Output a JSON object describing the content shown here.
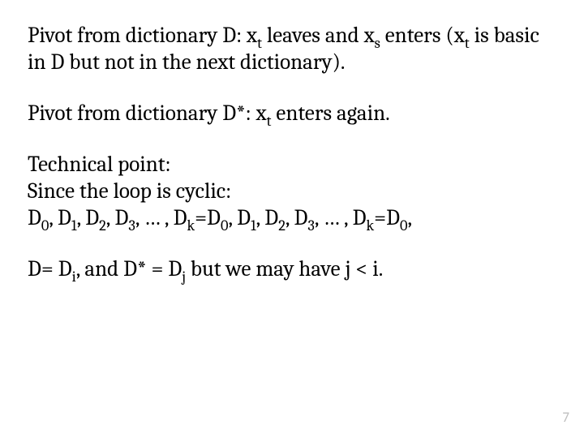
{
  "para1": {
    "t1": "Pivot from dictionary D: x",
    "sub1": "t",
    "t2": " leaves and x",
    "sub2": "s",
    "t3": " enters (x",
    "sub3": "t",
    "t4": " is basic in D but not in the next dictionary)."
  },
  "para2": {
    "t1": "Pivot from dictionary D*: x",
    "sub1": "t",
    "t2": " enters again."
  },
  "para3a": "Technical point:",
  "para3b": "Since the loop is cyclic:",
  "para3c": {
    "t1": "D",
    "s1": "0",
    "t2": ", D",
    "s2": "1",
    "t3": ", D",
    "s3": "2",
    "t4": ", D",
    "s4": "3",
    "t5": ", … , D",
    "s5": "k",
    "t6": "=D",
    "s6": "0",
    "t7": ", D",
    "s7": "1",
    "t8": ", D",
    "s8": "2",
    "t9": ", D",
    "s9": "3",
    "t10": ", … , D",
    "s10": "k",
    "t11": "=D",
    "s11": "0",
    "t12": ","
  },
  "para4": {
    "t1": "D= D",
    "s1": "i",
    "t2": ", and D* = D",
    "s2": "j",
    "t3": " but we may have j < i."
  },
  "page_number": "7"
}
